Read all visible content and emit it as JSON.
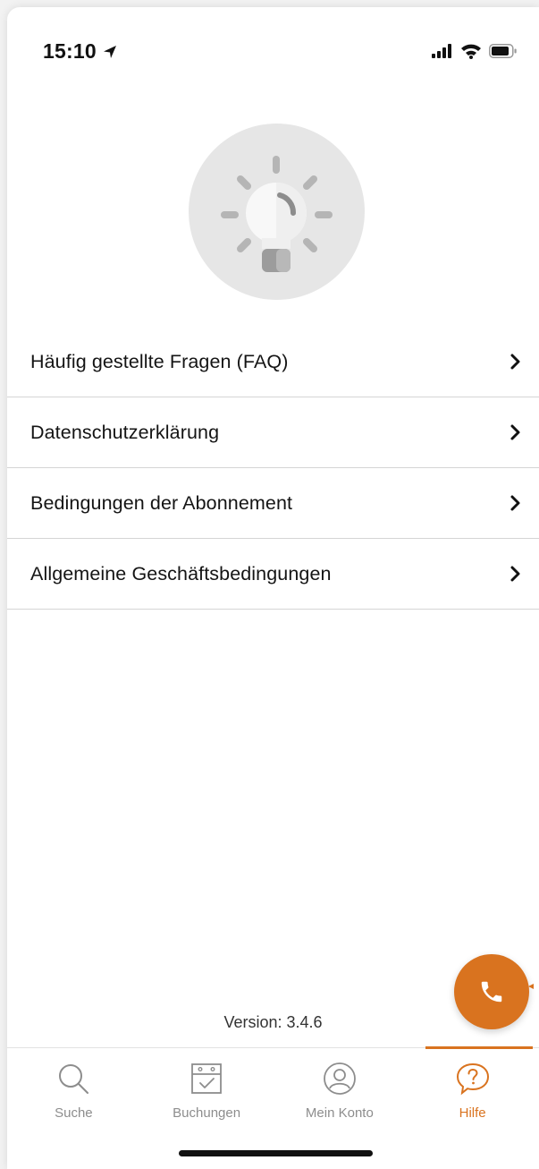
{
  "status_bar": {
    "time": "15:10",
    "icons": [
      "location-arrow-icon",
      "signal-icon",
      "wifi-icon",
      "battery-icon"
    ]
  },
  "hero": {
    "icon": "lightbulb-icon"
  },
  "menu": {
    "items": [
      {
        "label": "Häufig gestellte Fragen (FAQ)"
      },
      {
        "label": "Datenschutzerklärung"
      },
      {
        "label": "Bedingungen der Abonnement"
      },
      {
        "label": "Allgemeine Geschäftsbedingungen"
      }
    ]
  },
  "version": "Version: 3.4.6",
  "fab": {
    "icon": "phone-icon"
  },
  "tab_bar": {
    "active_color": "#d9731f",
    "inactive_color": "#8d8d8d",
    "tabs": [
      {
        "label": "Suche",
        "icon": "search-icon",
        "active": false
      },
      {
        "label": "Buchungen",
        "icon": "calendar-icon",
        "active": false
      },
      {
        "label": "Mein Konto",
        "icon": "user-icon",
        "active": false
      },
      {
        "label": "Hilfe",
        "icon": "help-icon",
        "active": true
      }
    ]
  }
}
